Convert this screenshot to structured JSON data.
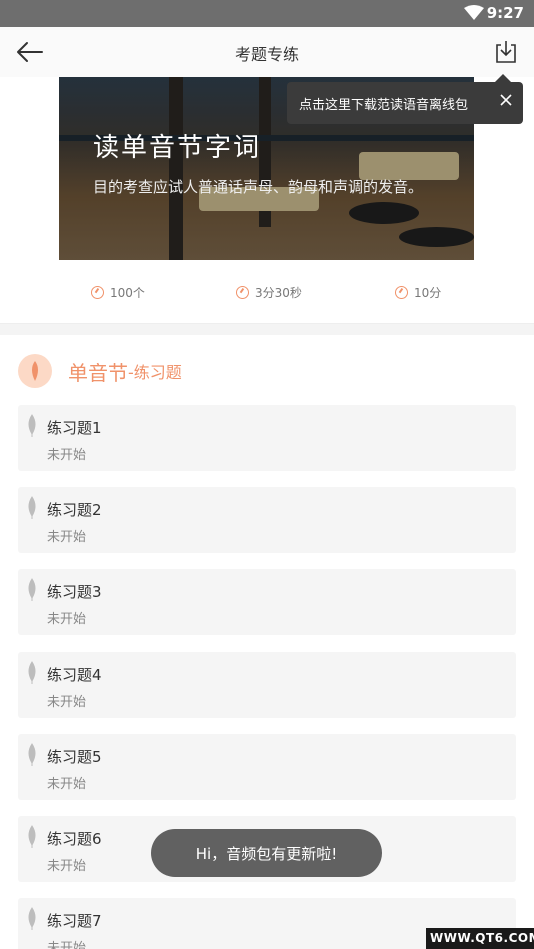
{
  "status_bar": {
    "time": "9:27",
    "wifi_icon": "wifi-icon"
  },
  "app_bar": {
    "title": "考题专练",
    "back_icon": "back-arrow-icon",
    "download_icon": "download-icon"
  },
  "tooltip": {
    "text": "点击这里下载范读语音离线包",
    "close_icon": "close-icon"
  },
  "banner": {
    "title": "读单音节字词",
    "description": "目的考查应试人普通话声母、韵母和声调的发音。"
  },
  "stats": [
    {
      "icon": "count-icon",
      "value": "100个"
    },
    {
      "icon": "clock-icon",
      "value": "3分30秒"
    },
    {
      "icon": "score-icon",
      "value": "10分"
    }
  ],
  "section": {
    "icon": "leaf-icon",
    "name": "单音节",
    "subtitle": "-练习题"
  },
  "exercises": [
    {
      "title": "练习题1",
      "status": "未开始"
    },
    {
      "title": "练习题2",
      "status": "未开始"
    },
    {
      "title": "练习题3",
      "status": "未开始"
    },
    {
      "title": "练习题4",
      "status": "未开始"
    },
    {
      "title": "练习题5",
      "status": "未开始"
    },
    {
      "title": "练习题6",
      "status": "未开始"
    },
    {
      "title": "练习题7",
      "status": "未开始"
    }
  ],
  "toast": {
    "text": "Hi，音频包有更新啦!"
  },
  "watermark": {
    "text": "WWW.QT6.COM"
  },
  "colors": {
    "accent": "#f0926a",
    "accent_light": "#fcd9c6",
    "card_bg": "#f5f5f5",
    "status_bar": "#6e6e6e"
  }
}
